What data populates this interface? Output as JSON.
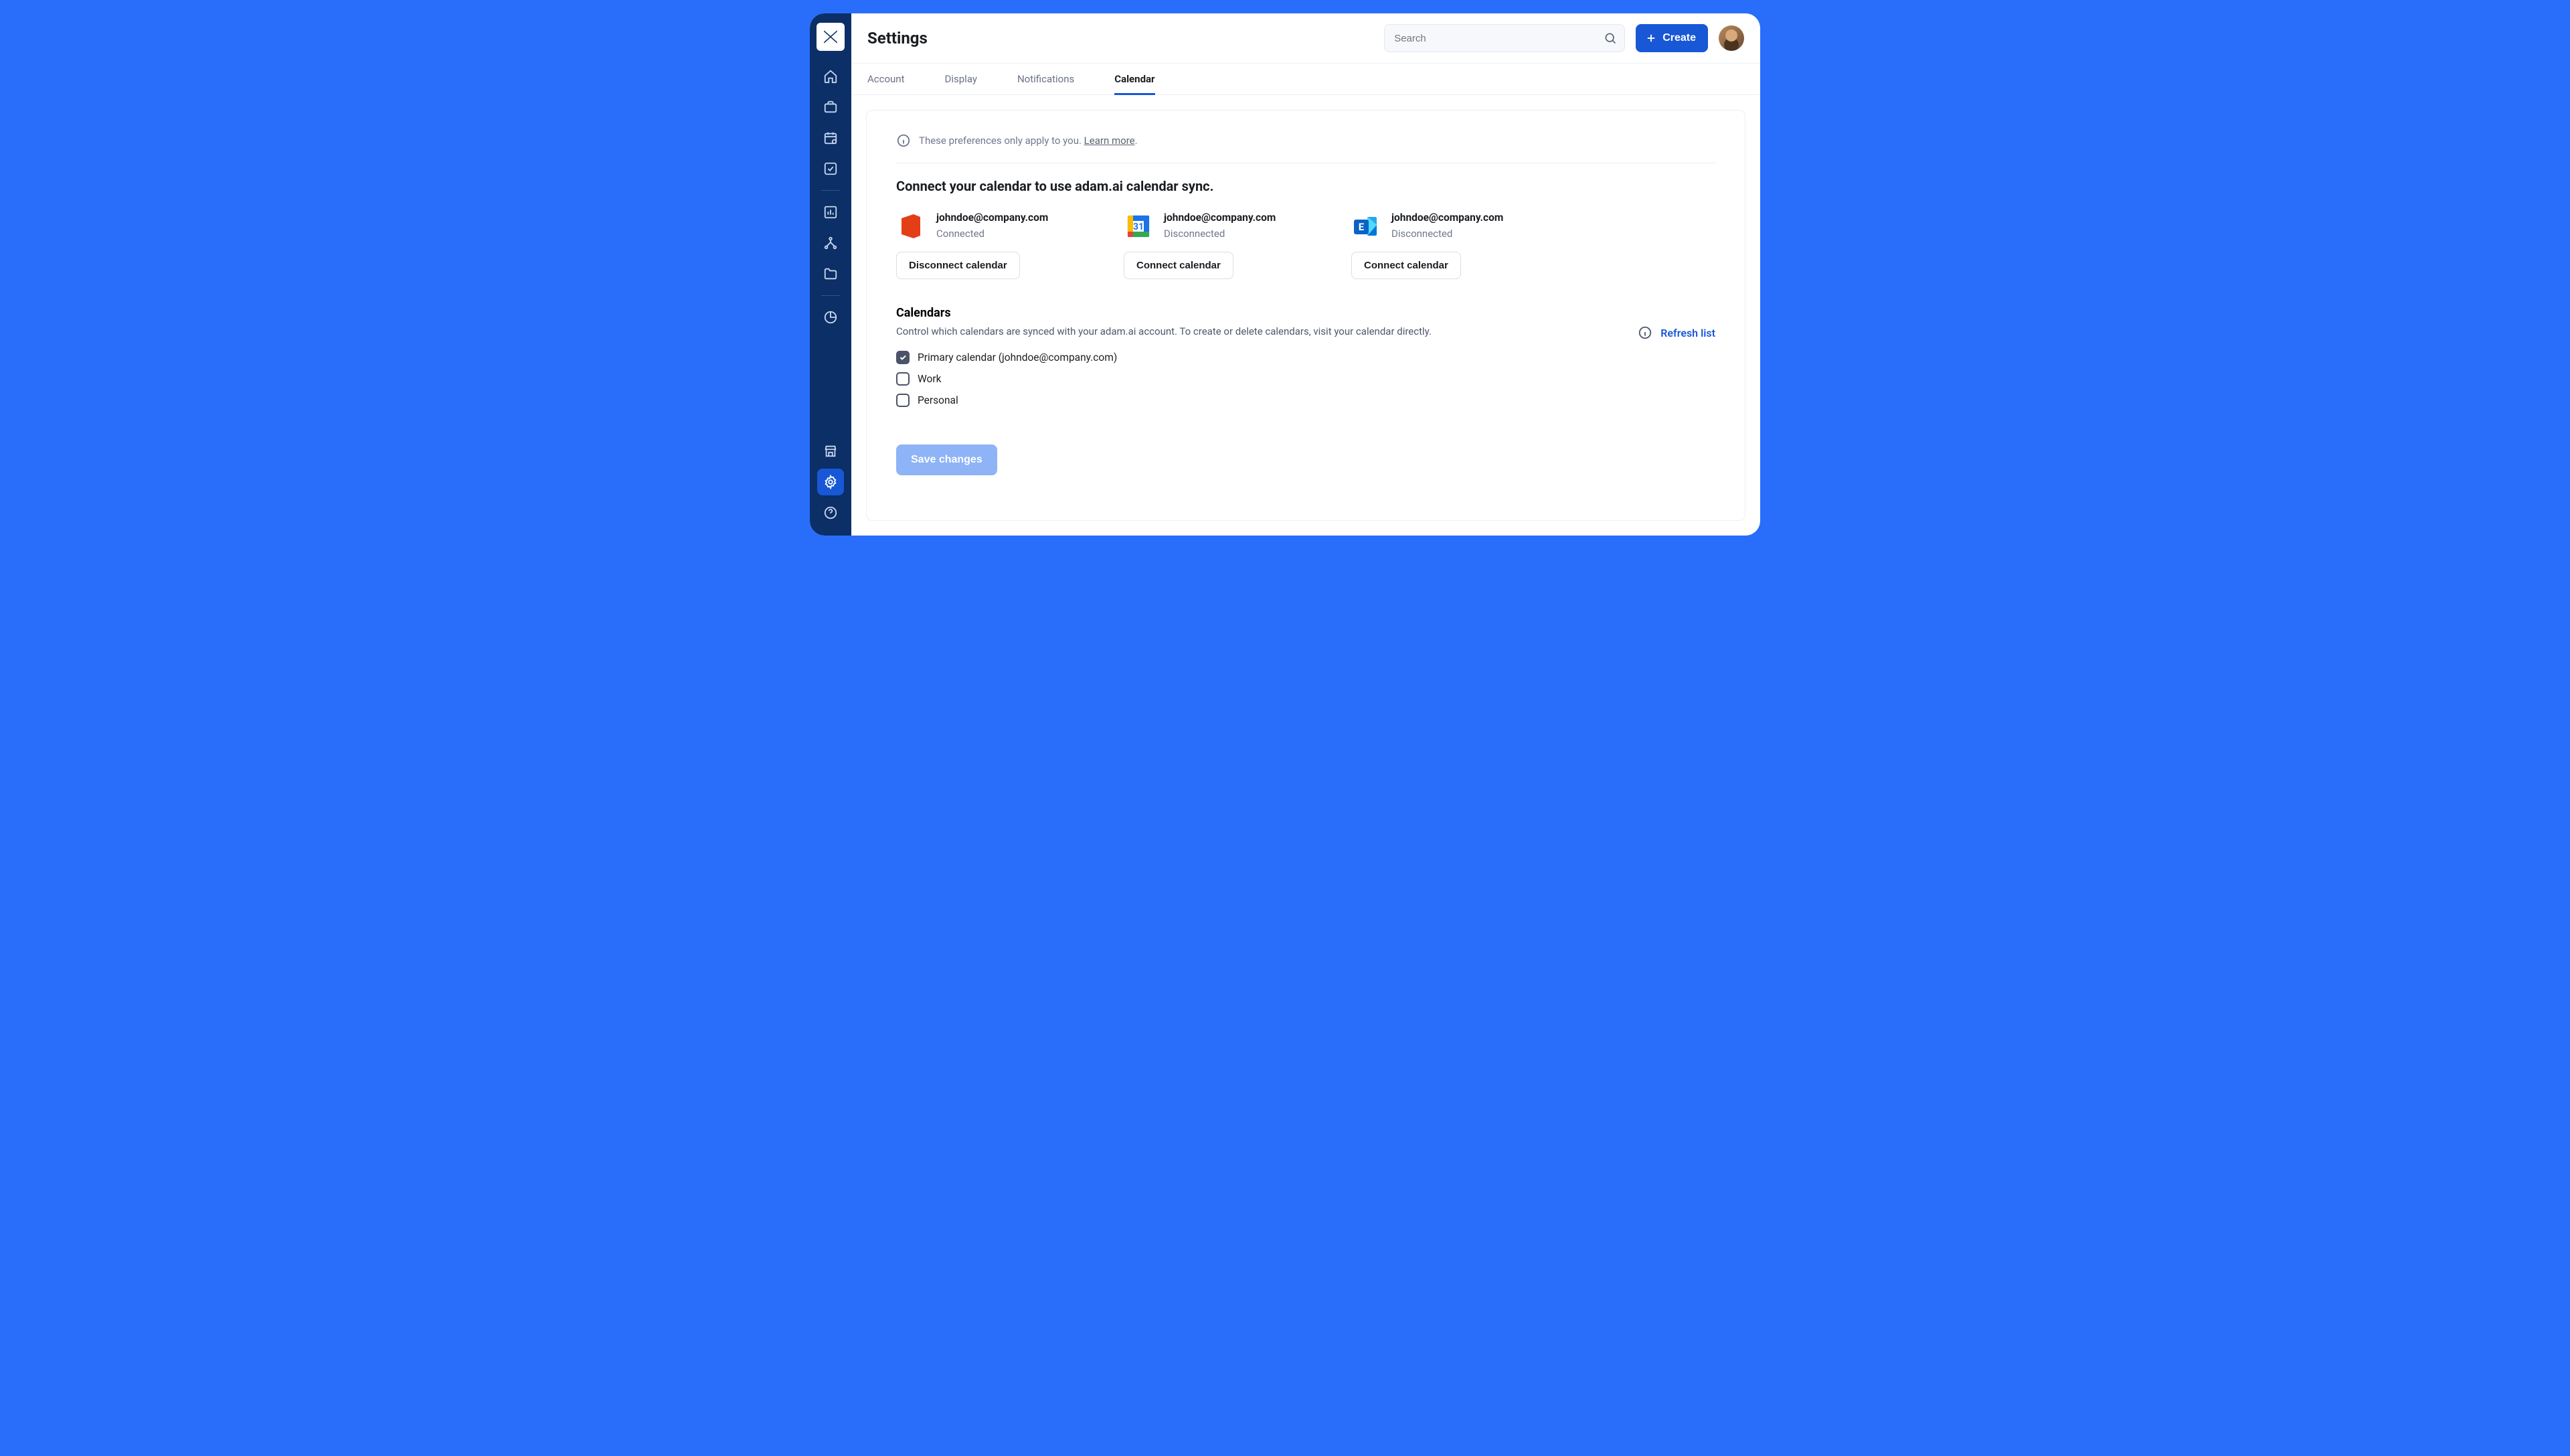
{
  "header": {
    "title": "Settings",
    "search_placeholder": "Search",
    "create_label": "Create"
  },
  "tabs": [
    {
      "label": "Account"
    },
    {
      "label": "Display"
    },
    {
      "label": "Notifications"
    },
    {
      "label": "Calendar"
    }
  ],
  "active_tab": 3,
  "info": {
    "text": "These preferences only apply to you.",
    "link": "Learn more",
    "suffix": "."
  },
  "connect_section": {
    "title": "Connect your calendar to use adam.ai calendar sync."
  },
  "providers": [
    {
      "email": "johndoe@company.com",
      "status": "Connected",
      "button": "Disconnect calendar",
      "icon": "office365"
    },
    {
      "email": "johndoe@company.com",
      "status": "Disconnected",
      "button": "Connect calendar",
      "icon": "google-calendar"
    },
    {
      "email": "johndoe@company.com",
      "status": "Disconnected",
      "button": "Connect calendar",
      "icon": "exchange"
    }
  ],
  "calendars": {
    "title": "Calendars",
    "descr": "Control which calendars are synced with your adam.ai account. To create or delete calendars, visit your calendar directly.",
    "refresh_label": "Refresh list",
    "items": [
      {
        "label": "Primary calendar (johndoe@company.com)",
        "checked": true
      },
      {
        "label": "Work",
        "checked": false
      },
      {
        "label": "Personal",
        "checked": false
      }
    ]
  },
  "save_label": "Save changes",
  "sidebar_icons": [
    "home-icon",
    "briefcase-icon",
    "calendar-check-icon",
    "checkbox-icon",
    "chart-bar-icon",
    "branch-icon",
    "folder-icon",
    "pie-icon",
    "storefront-icon",
    "gear-icon",
    "help-icon"
  ]
}
